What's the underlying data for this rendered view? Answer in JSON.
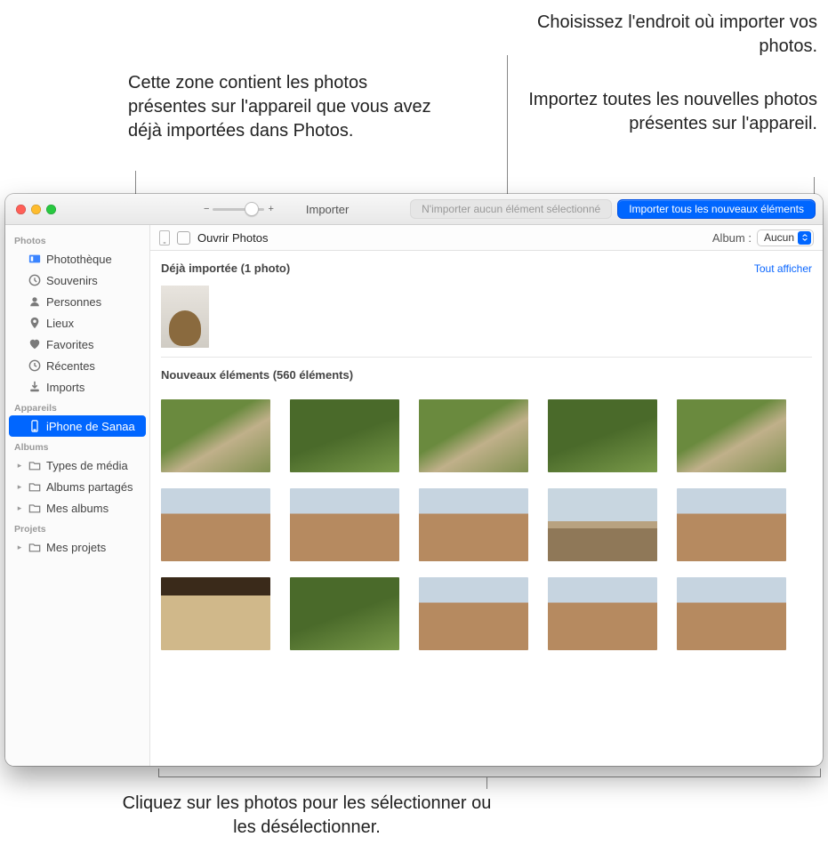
{
  "callouts": {
    "already": "Cette zone contient les photos présentes sur l'appareil que vous avez déjà importées dans Photos.",
    "dest": "Choisissez l'endroit où importer vos photos.",
    "all": "Importez toutes les nouvelles photos présentes sur l'appareil.",
    "select": "Cliquez sur les photos pour les sélectionner ou les désélectionner."
  },
  "toolbar": {
    "title": "Importer",
    "import_selected": "N'importer aucun élément sélectionné",
    "import_all": "Importer tous les nouveaux éléments"
  },
  "options": {
    "open_photos": "Ouvrir Photos",
    "album_label": "Album :",
    "album_value": "Aucun"
  },
  "sidebar": {
    "sections": {
      "photos": "Photos",
      "devices": "Appareils",
      "albums": "Albums",
      "projects": "Projets"
    },
    "items": {
      "library": "Photothèque",
      "memories": "Souvenirs",
      "people": "Personnes",
      "places": "Lieux",
      "favorites": "Favorites",
      "recent": "Récentes",
      "imports": "Imports",
      "device": "iPhone de Sanaa",
      "media": "Types de média",
      "shared": "Albums partagés",
      "myalbums": "Mes albums",
      "myprojects": "Mes projets"
    }
  },
  "sections": {
    "already": {
      "title": "Déjà importée (1 photo)",
      "show_all": "Tout afficher"
    },
    "new": {
      "title": "Nouveaux éléments (560 éléments)"
    }
  }
}
